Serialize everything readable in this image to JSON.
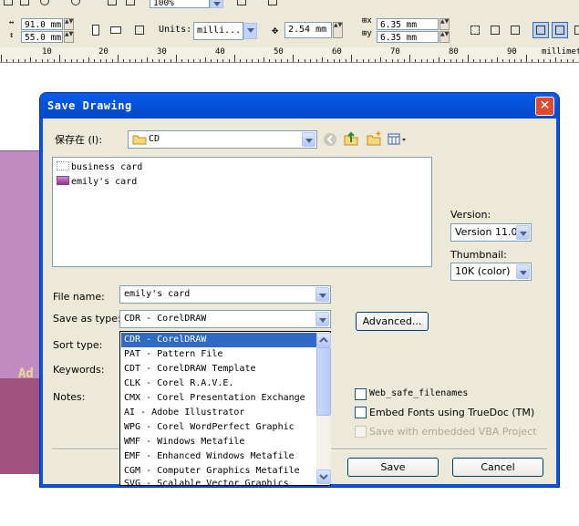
{
  "toolbar": {
    "width_value": "91.0 mm",
    "height_value": "55.0 mm",
    "zoom_value": "100%",
    "units_label": "Units:",
    "units_value": "milli...",
    "nudge_value": "2.54 mm",
    "dup_x_value": "6.35 mm",
    "dup_y_value": "6.35 mm",
    "dup_x_prefix": "x",
    "dup_y_prefix": "y"
  },
  "ruler": {
    "labels": [
      "10",
      "20",
      "30",
      "40",
      "50",
      "60",
      "70",
      "80",
      "90"
    ],
    "unit": "millimet"
  },
  "canvas": {
    "card_text": "Ad"
  },
  "dialog": {
    "title": "Save Drawing",
    "close_glyph": "✕",
    "save_in_label": "保存在 (I):",
    "save_in_value": "CD",
    "files": [
      {
        "name": "business card",
        "icon": "blank-document-icon"
      },
      {
        "name": "emily's card",
        "icon": "coreldraw-document-icon"
      }
    ],
    "version_label": "Version:",
    "version_value": "Version 11.0",
    "thumbnail_label": "Thumbnail:",
    "thumbnail_value": "10K (color)",
    "file_name_label": "File name:",
    "file_name_value": "emily's card",
    "save_as_type_label": "Save as type:",
    "save_as_type_value": "CDR - CorelDRAW",
    "sort_type_label": "Sort type:",
    "keywords_label": "Keywords:",
    "notes_label": "Notes:",
    "advanced_button": "Advanced...",
    "web_safe_label": "Web_safe_filenames",
    "embed_fonts_label": "Embed Fonts using TrueDoc (TM)",
    "vba_label": "Save with embedded VBA Project",
    "save_button": "Save",
    "cancel_button": "Cancel",
    "type_options": [
      "CDR - CorelDRAW",
      "PAT - Pattern File",
      "CDT - CorelDRAW Template",
      "CLK - Corel R.A.V.E.",
      "CMX - Corel Presentation Exchange",
      "AI - Adobe Illustrator",
      "WPG - Corel WordPerfect Graphic",
      "WMF - Windows Metafile",
      "EMF - Enhanced Windows Metafile",
      "CGM - Computer Graphics Metafile",
      "SVG - Scalable Vector Graphics"
    ]
  },
  "colors": {
    "title_bar": "#0a54e2",
    "selection": "#316ac5",
    "dialog_face": "#ece9d8",
    "close_button": "#e04a2a"
  }
}
